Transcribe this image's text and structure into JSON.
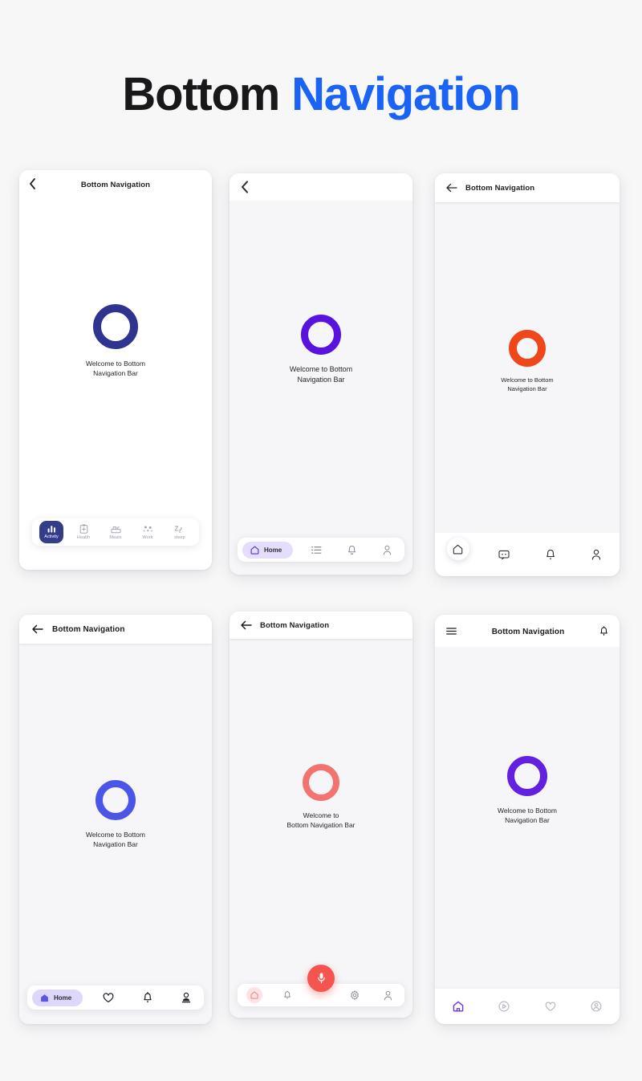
{
  "heading": {
    "part1": "Bottom",
    "part2": "Navigation"
  },
  "colors": {
    "heading_dark": "#18181b",
    "heading_blue": "#1a63f5",
    "page_bg": "#f7f7f8",
    "navy": "#2f3490",
    "violet": "#5a12df",
    "orange": "#f0471a",
    "indigo": "#4b56e8",
    "coral": "#f47272",
    "purple": "#6320e0",
    "pill_lavender": "#e4ddfb",
    "pill_dark": "#343c8c",
    "pink_soft": "#fde3e3"
  },
  "phones": [
    {
      "id": "phone-1",
      "appbar": {
        "back_icon": "chevron-left-icon",
        "title": "Bottom Navigation",
        "title_align": "center"
      },
      "hero": {
        "ring_color": "#2f3490",
        "text": "Welcome to Bottom\nNavigation Bar"
      },
      "nav": {
        "style": "labeled-card",
        "items": [
          {
            "label": "Activity",
            "icon": "bar-chart-icon",
            "active": true
          },
          {
            "label": "Health",
            "icon": "clipboard-health-icon",
            "active": false
          },
          {
            "label": "Meals",
            "icon": "meal-tray-icon",
            "active": false
          },
          {
            "label": "Work",
            "icon": "dots-work-icon",
            "active": false
          },
          {
            "label": "sleep",
            "icon": "zzz-sleep-icon",
            "active": false
          }
        ]
      }
    },
    {
      "id": "phone-2",
      "appbar": {
        "back_icon": "chevron-left-icon",
        "title": "",
        "title_align": "left"
      },
      "hero": {
        "ring_color": "#5a12df",
        "text": "Welcome to Bottom\nNavigation Bar"
      },
      "nav": {
        "style": "pill-card",
        "items": [
          {
            "label": "Home",
            "icon": "home-outline-icon",
            "active": true
          },
          {
            "label": "",
            "icon": "list-icon",
            "active": false
          },
          {
            "label": "",
            "icon": "bell-icon",
            "active": false
          },
          {
            "label": "",
            "icon": "person-icon",
            "active": false
          }
        ]
      }
    },
    {
      "id": "phone-3",
      "appbar": {
        "back_icon": "arrow-left-icon",
        "title": "Bottom Navigation",
        "title_align": "left"
      },
      "hero": {
        "ring_color": "#f0471a",
        "text": "Welcome to Bottom\nNavigation Bar"
      },
      "nav": {
        "style": "raised-home",
        "items": [
          {
            "label": "",
            "icon": "home-outline-icon",
            "active": true
          },
          {
            "label": "",
            "icon": "chat-bubble-icon",
            "active": false
          },
          {
            "label": "",
            "icon": "bell-icon",
            "active": false
          },
          {
            "label": "",
            "icon": "person-icon",
            "active": false
          }
        ]
      }
    },
    {
      "id": "phone-4",
      "appbar": {
        "back_icon": "arrow-left-icon",
        "title": "Bottom Navigation",
        "title_align": "left"
      },
      "hero": {
        "ring_color": "#4b56e8",
        "text": "Welcome to Bottom\nNavigation Bar"
      },
      "nav": {
        "style": "pill-card-filled",
        "items": [
          {
            "label": "Home",
            "icon": "home-filled-icon",
            "active": true
          },
          {
            "label": "",
            "icon": "heart-icon",
            "active": false
          },
          {
            "label": "",
            "icon": "bell-icon",
            "active": false
          },
          {
            "label": "",
            "icon": "person-badge-icon",
            "active": false
          }
        ]
      }
    },
    {
      "id": "phone-5",
      "appbar": {
        "back_icon": "arrow-left-icon",
        "title": "Bottom Navigation",
        "title_align": "left"
      },
      "hero": {
        "ring_color": "#f47272",
        "text": "Welcome to\nBottom Navigation Bar"
      },
      "nav": {
        "style": "fab-center",
        "fab_icon": "microphone-icon",
        "fab_color": "#f5544f",
        "items": [
          {
            "label": "",
            "icon": "home-outline-icon",
            "active": true
          },
          {
            "label": "",
            "icon": "bell-icon",
            "active": false
          },
          {
            "label": "",
            "icon": "gear-icon",
            "active": false
          },
          {
            "label": "",
            "icon": "person-icon",
            "active": false
          }
        ]
      }
    },
    {
      "id": "phone-6",
      "appbar": {
        "menu_icon": "hamburger-menu-icon",
        "title": "Bottom Navigation",
        "title_align": "center",
        "action_icon": "bell-icon"
      },
      "hero": {
        "ring_color": "#6320e0",
        "text": "Welcome to Bottom\nNavigation Bar"
      },
      "nav": {
        "style": "flat-icons",
        "items": [
          {
            "label": "",
            "icon": "home-outline-icon",
            "active": true
          },
          {
            "label": "",
            "icon": "play-circle-icon",
            "active": false
          },
          {
            "label": "",
            "icon": "heart-icon",
            "active": false
          },
          {
            "label": "",
            "icon": "person-circle-icon",
            "active": false
          }
        ]
      }
    }
  ]
}
